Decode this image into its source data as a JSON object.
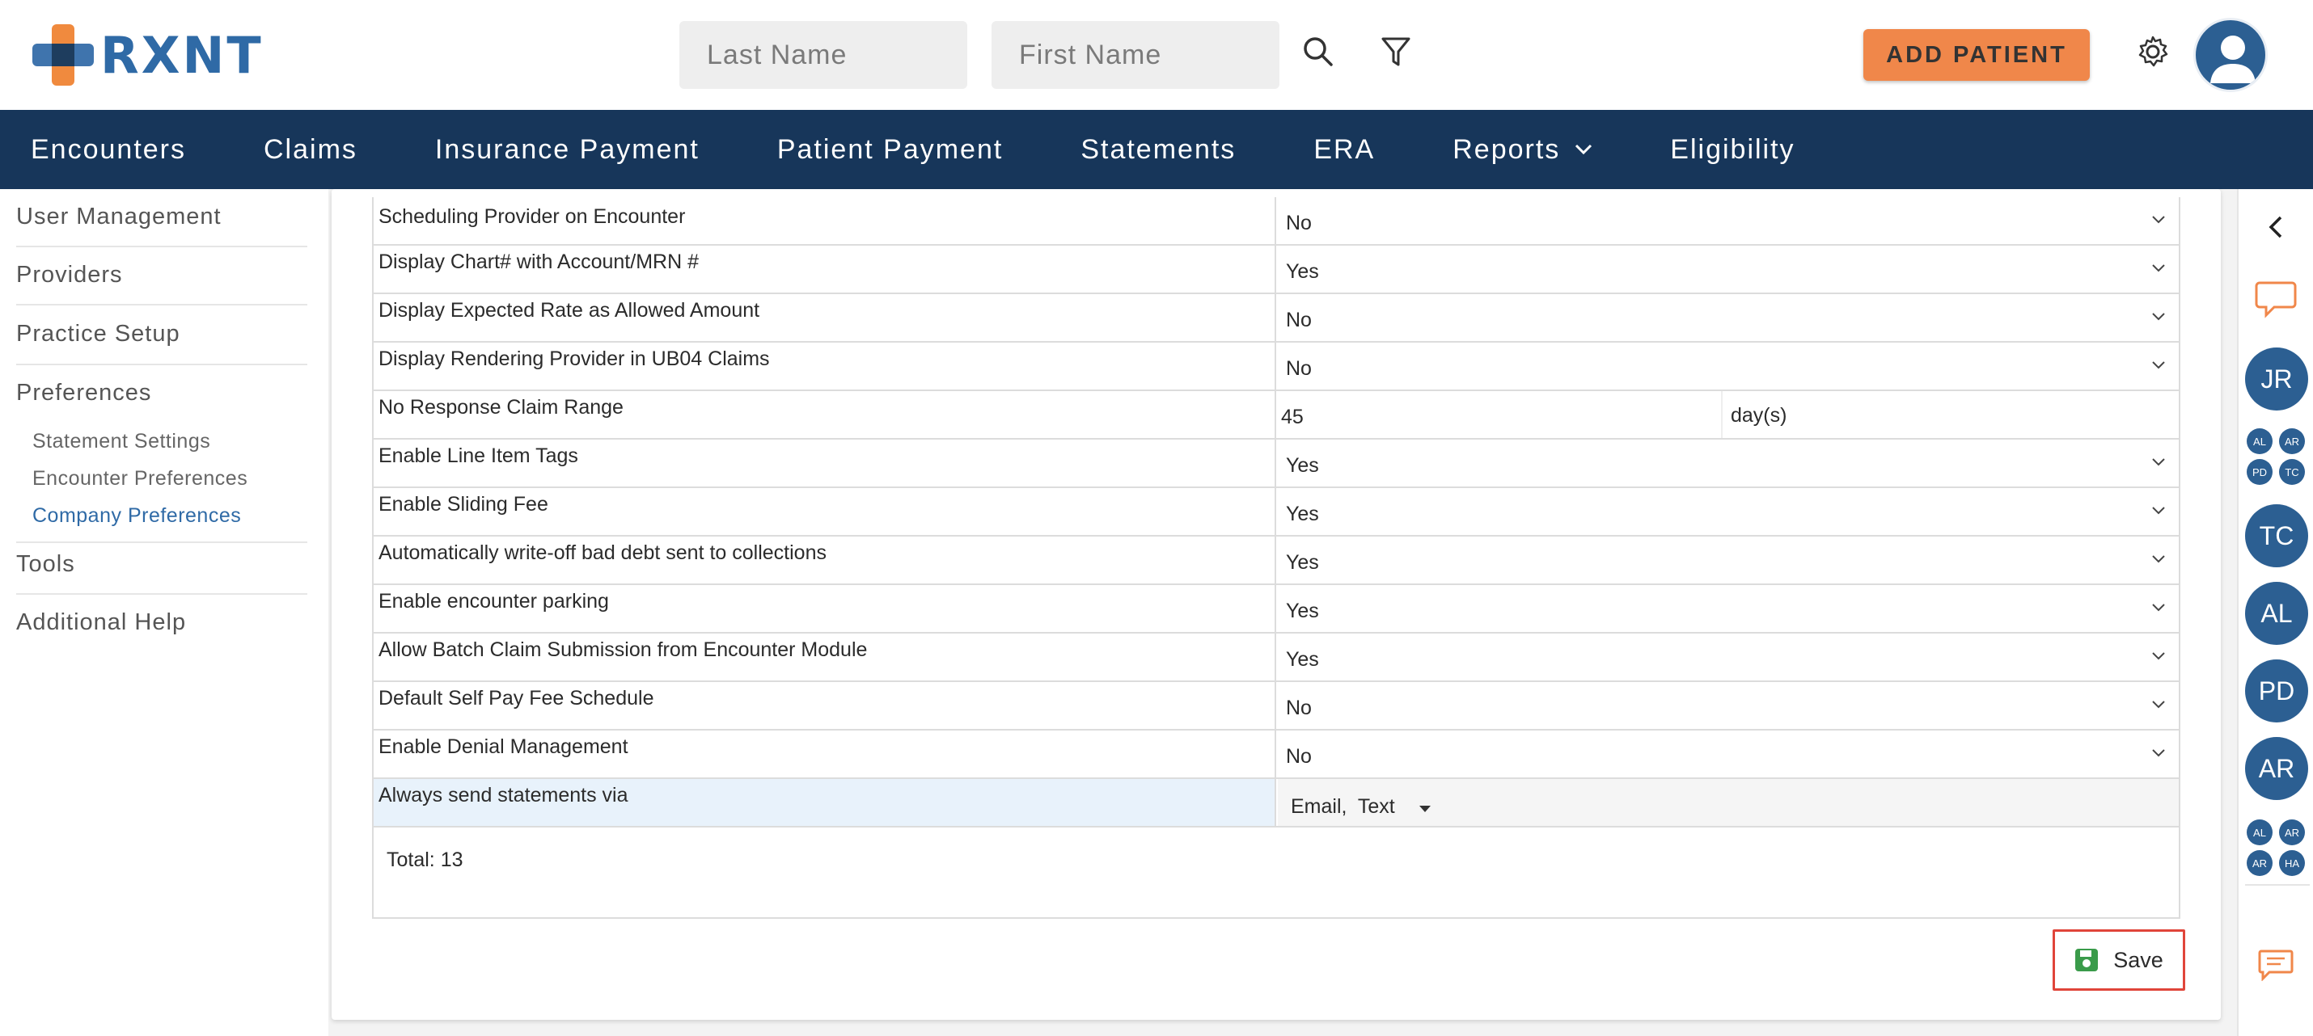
{
  "header": {
    "logo_text": "RXNT",
    "last_name_placeholder": "Last Name",
    "first_name_placeholder": "First Name",
    "add_patient_label": "ADD PATIENT",
    "search_icon": "search-icon",
    "filter_icon": "filter-icon",
    "settings_icon": "gear-icon",
    "avatar_icon": "user-avatar-icon"
  },
  "nav": {
    "items": [
      "Encounters",
      "Claims",
      "Insurance Payment",
      "Patient Payment",
      "Statements",
      "ERA",
      "Reports",
      "Eligibility"
    ]
  },
  "sidebar": {
    "items": [
      "User Management",
      "Providers",
      "Practice Setup",
      "Preferences",
      "Tools",
      "Additional Help"
    ],
    "sub_items": [
      "Statement Settings",
      "Encounter Preferences",
      "Company Preferences"
    ],
    "active_sub": "Company Preferences"
  },
  "preferences": {
    "rows": [
      {
        "label": "Scheduling Provider on Encounter",
        "value": "No"
      },
      {
        "label": "Display Chart# with Account/MRN #",
        "value": "Yes"
      },
      {
        "label": "Display Expected Rate as Allowed Amount",
        "value": "No"
      },
      {
        "label": "Display Rendering Provider in UB04 Claims",
        "value": "No"
      },
      {
        "label": "No Response Claim Range",
        "value": "45",
        "unit": "day(s)"
      },
      {
        "label": "Enable Line Item Tags",
        "value": "Yes"
      },
      {
        "label": "Enable Sliding Fee",
        "value": "Yes"
      },
      {
        "label": "Automatically write-off bad debt sent to collections",
        "value": "Yes"
      },
      {
        "label": "Enable encounter parking",
        "value": "Yes"
      },
      {
        "label": "Allow Batch Claim Submission from Encounter Module",
        "value": "Yes"
      },
      {
        "label": "Default Self Pay Fee Schedule",
        "value": "No"
      },
      {
        "label": "Enable Denial Management",
        "value": "No"
      },
      {
        "label": "Always send statements via",
        "value": "Email,  Text"
      }
    ],
    "total_label": "Total: 13",
    "save_label": "Save"
  },
  "rail": {
    "big_bubbles": [
      "JR",
      "TC",
      "AL",
      "PD",
      "AR"
    ],
    "small_group_1": [
      "AL",
      "AR",
      "PD",
      "TC"
    ],
    "small_group_2": [
      "AL",
      "AR",
      "AR",
      "HA"
    ]
  },
  "colors": {
    "nav_bg": "#17365a",
    "accent_orange": "#f0874a",
    "brand_blue": "#2f6aa6",
    "save_border": "#e0453a"
  }
}
